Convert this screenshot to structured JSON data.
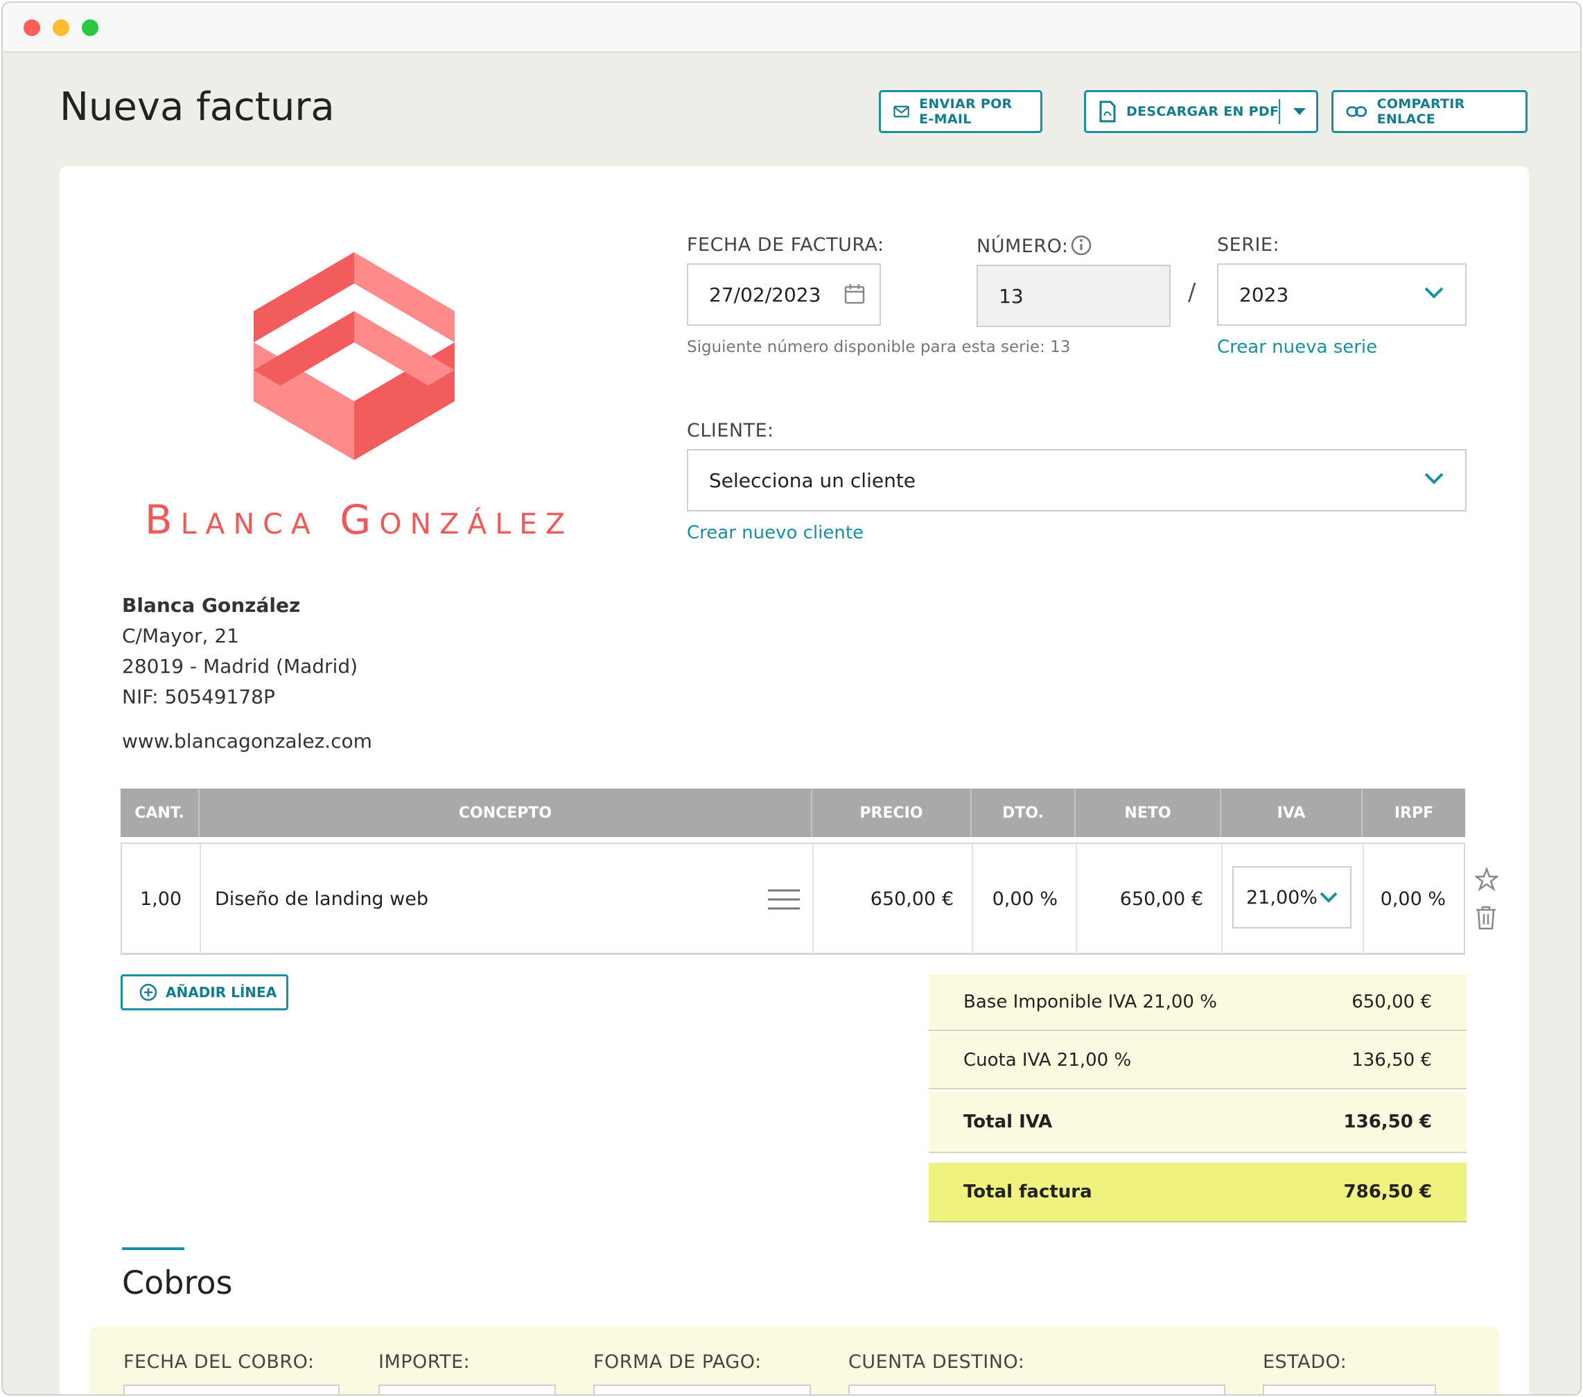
{
  "window": {
    "controls": [
      "close",
      "minimize",
      "maximize"
    ]
  },
  "header": {
    "title": "Nueva factura",
    "buttons": {
      "email": "ENVIAR POR E-MAIL",
      "pdf": "DESCARGAR EN PDF",
      "share": "COMPARTIR ENLACE"
    }
  },
  "brand": {
    "name": "Blanca González",
    "logo_color": "#ee5a5a"
  },
  "issuer": {
    "name": "Blanca González",
    "address": "C/Mayor, 21",
    "city": "28019 - Madrid (Madrid)",
    "nif": "NIF: 50549178P",
    "web": "www.blancagonzalez.com"
  },
  "form": {
    "date_label": "FECHA DE FACTURA:",
    "date_value": "27/02/2023",
    "number_label": "NÚMERO:",
    "number_value": "13",
    "number_help": "Siguiente número disponible para esta serie: 13",
    "separator": "/",
    "series_label": "SERIE:",
    "series_value": "2023",
    "new_series_link": "Crear nueva serie",
    "client_label": "CLIENTE:",
    "client_placeholder": "Selecciona un cliente",
    "new_client_link": "Crear nuevo cliente"
  },
  "table": {
    "headers": [
      "CANT.",
      "CONCEPTO",
      "PRECIO",
      "DTO.",
      "NETO",
      "IVA",
      "IRPF"
    ],
    "rows": [
      {
        "qty": "1,00",
        "concept": "Diseño de landing web",
        "price": "650,00 €",
        "discount": "0,00 %",
        "net": "650,00 €",
        "iva": "21,00%",
        "irpf": "0,00 %"
      }
    ],
    "add_line": "AÑADIR LÍNEA"
  },
  "totals": [
    {
      "label": "Base Imponible IVA 21,00 %",
      "value": "650,00 €"
    },
    {
      "label": "Cuota IVA 21,00 %",
      "value": "136,50 €"
    },
    {
      "label": "Total IVA",
      "value": "136,50 €"
    },
    {
      "label": "Total factura",
      "value": "786,50 €"
    }
  ],
  "cobros": {
    "title": "Cobros",
    "columns": [
      "FECHA DEL COBRO:",
      "IMPORTE:",
      "FORMA DE PAGO:",
      "CUENTA DESTINO:",
      "ESTADO:"
    ]
  },
  "colors": {
    "accent": "#1a8fa0",
    "total_highlight": "#eff37e",
    "totals_bg": "#fafae0",
    "table_header": "#a9a9a9"
  }
}
